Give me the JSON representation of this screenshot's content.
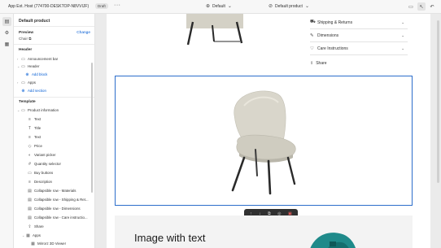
{
  "topbar": {
    "app_name": "App Ext. Host (774700-DESKTOP-N8VVIJF)",
    "status_badge": "Draft",
    "more_label": "···",
    "theme_dropdown": "Default",
    "template_dropdown": "Default product",
    "icons": [
      "monitor-icon",
      "cursor-select-icon",
      "undo-icon"
    ]
  },
  "rail": {
    "icons": [
      "sections-icon",
      "settings-gear-icon",
      "apps-icon"
    ]
  },
  "panel": {
    "title": "Default product",
    "preview_label": "Preview",
    "change_label": "Change",
    "preview_value": "Chair",
    "header_section": "Header",
    "header_items": [
      {
        "label": "Announcement bar",
        "icon": "layout-icon"
      },
      {
        "label": "Header",
        "icon": "layout-icon"
      }
    ],
    "add_block": "Add block",
    "header_more": [
      {
        "label": "Apps",
        "icon": "layout-icon"
      }
    ],
    "add_section": "Add section",
    "template_section": "Template",
    "product_info": "Product information",
    "blocks": [
      {
        "label": "Text",
        "icon": "text-icon"
      },
      {
        "label": "Title",
        "icon": "title-icon"
      },
      {
        "label": "Text",
        "icon": "text-icon"
      },
      {
        "label": "Price",
        "icon": "price-icon"
      },
      {
        "label": "Variant picker",
        "icon": "variant-picker-icon"
      },
      {
        "label": "Quantity selector",
        "icon": "quantity-icon"
      },
      {
        "label": "Buy buttons",
        "icon": "buy-buttons-icon"
      },
      {
        "label": "Description",
        "icon": "description-icon"
      },
      {
        "label": "Collapsible row - Materials",
        "icon": "collapsible-icon"
      },
      {
        "label": "Collapsible row - Shipping & Ret...",
        "icon": "collapsible-icon"
      },
      {
        "label": "Collapsible row - Dimensions",
        "icon": "collapsible-icon"
      },
      {
        "label": "Collapsible row - Care instructio...",
        "icon": "collapsible-icon"
      },
      {
        "label": "Share",
        "icon": "share-icon"
      }
    ],
    "apps_label": "Apps",
    "app_block": "Mirrorz 3D Viewer"
  },
  "preview": {
    "accordion": [
      {
        "label": "Shipping & Returns",
        "icon": "truck-icon"
      },
      {
        "label": "Dimensions",
        "icon": "ruler-icon"
      },
      {
        "label": "Care Instructions",
        "icon": "heart-icon"
      }
    ],
    "share_label": "Share",
    "image_with_text_heading": "Image with text",
    "colors": {
      "selection": "#2c6ecb",
      "chair_fabric": "#d9d6cb",
      "legs": "#2a2a2a",
      "accent": "#1f8a8a"
    }
  }
}
